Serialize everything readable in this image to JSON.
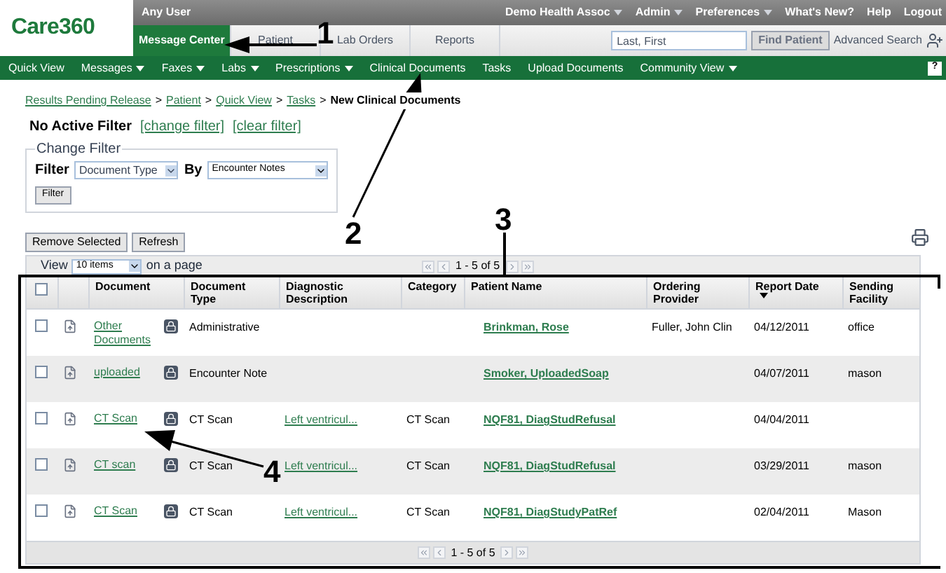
{
  "header": {
    "logo": "Care360",
    "user": "Any User",
    "top_links": [
      {
        "label": "Demo Health Assoc",
        "dropdown": true
      },
      {
        "label": "Admin",
        "dropdown": true
      },
      {
        "label": "Preferences",
        "dropdown": true
      },
      {
        "label": "What's New?",
        "dropdown": false
      },
      {
        "label": "Help",
        "dropdown": false
      },
      {
        "label": "Logout",
        "dropdown": false
      }
    ],
    "tabs": [
      {
        "label": "Message Center",
        "selected": true
      },
      {
        "label": "Patient",
        "selected": false
      },
      {
        "label": "Lab Orders",
        "selected": false
      },
      {
        "label": "Reports",
        "selected": false
      }
    ],
    "search": {
      "placeholder": "Last, First"
    },
    "find_button": "Find Patient",
    "advanced_search": "Advanced Search"
  },
  "nav": [
    {
      "label": "Quick View",
      "dropdown": false
    },
    {
      "label": "Messages",
      "dropdown": true
    },
    {
      "label": "Faxes",
      "dropdown": true
    },
    {
      "label": "Labs",
      "dropdown": true
    },
    {
      "label": "Prescriptions",
      "dropdown": true
    },
    {
      "label": "Clinical Documents",
      "dropdown": false
    },
    {
      "label": "Tasks",
      "dropdown": false
    },
    {
      "label": "Upload Documents",
      "dropdown": false
    },
    {
      "label": "Community View",
      "dropdown": true
    }
  ],
  "help": "?",
  "breadcrumb": [
    {
      "label": "Results Pending Release",
      "link": true
    },
    {
      "label": "Patient",
      "link": true
    },
    {
      "label": "Quick View",
      "link": true
    },
    {
      "label": "Tasks",
      "link": true
    },
    {
      "label": "New Clinical Documents",
      "link": false
    }
  ],
  "breadcrumb_separator": ">",
  "filter_status": {
    "title": "No Active Filter",
    "links": [
      "[change filter]",
      "[clear filter]"
    ]
  },
  "change_filter": {
    "legend": "Change Filter",
    "filter_label": "Filter",
    "filter_value": "Document Type",
    "by_label": "By",
    "by_value": "Encounter Notes",
    "button": "Filter"
  },
  "actions": [
    "Remove Selected",
    "Refresh"
  ],
  "pager": {
    "view_label": "View",
    "page_size": "10 items",
    "suffix": "on a page",
    "range": "1 - 5 of 5"
  },
  "table": {
    "select_all": {
      "checked": false
    },
    "columns": [
      {
        "label": "Document",
        "sorted": false
      },
      {
        "label": "Document Type",
        "sorted": false
      },
      {
        "label": "Diagnostic Description",
        "sorted": false
      },
      {
        "label": "Category",
        "sorted": false
      },
      {
        "label": "Patient Name",
        "sorted": false
      },
      {
        "label": "Ordering Provider",
        "sorted": false
      },
      {
        "label": "Report Date",
        "sorted": true
      },
      {
        "label": "Sending Facility",
        "sorted": false
      }
    ],
    "rows": [
      {
        "checked": false,
        "document": "Other Documents",
        "type": "Administrative",
        "diagnosis": "",
        "category": "",
        "patient": "Brinkman, Rose",
        "provider": "Fuller, John Clin",
        "date": "04/12/2011",
        "facility": "office"
      },
      {
        "checked": false,
        "document": "uploaded",
        "type": "Encounter Note",
        "diagnosis": "",
        "category": "",
        "patient": "Smoker, UploadedSoap",
        "provider": "",
        "date": "04/07/2011",
        "facility": "mason"
      },
      {
        "checked": false,
        "document": "CT Scan",
        "type": "CT Scan",
        "diagnosis": "Left ventricul...",
        "category": "CT Scan",
        "patient": "NQF81, DiagStudRefusal",
        "provider": "",
        "date": "04/04/2011",
        "facility": ""
      },
      {
        "checked": false,
        "document": "CT scan",
        "type": "CT Scan",
        "diagnosis": "Left ventricul...",
        "category": "CT Scan",
        "patient": "NQF81, DiagStudRefusal",
        "provider": "",
        "date": "03/29/2011",
        "facility": "mason"
      },
      {
        "checked": false,
        "document": "CT Scan",
        "type": "CT Scan",
        "diagnosis": "Left ventricul...",
        "category": "CT Scan",
        "patient": "NQF81, DiagStudyPatRef",
        "provider": "",
        "date": "02/04/2011",
        "facility": "Mason"
      }
    ]
  },
  "bottom_pager": {
    "range": "1 - 5 of 5"
  },
  "callouts": [
    "1",
    "2",
    "3",
    "4"
  ]
}
